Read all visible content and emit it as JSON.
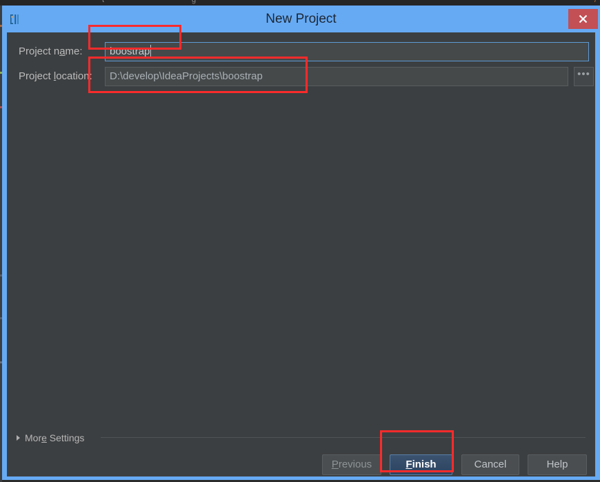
{
  "window": {
    "title": "New Project",
    "app_icon": "intellij-idea-icon",
    "close_label": "✕"
  },
  "form": {
    "name_label_pre": "Project n",
    "name_label_mnemonic": "a",
    "name_label_post": "me:",
    "name_value": "boostrap",
    "name_placeholder": "Project name",
    "location_label_pre": "Project ",
    "location_label_mnemonic": "l",
    "location_label_post": "ocation:",
    "location_value": "D:\\develop\\IdeaProjects\\boostrap",
    "location_placeholder": "Project location",
    "browse_label": "•••"
  },
  "more_settings": {
    "label_pre": "Mor",
    "label_mnemonic": "e",
    "label_post": " Settings",
    "expanded": "false",
    "triangle_icon": "chevron-right-icon"
  },
  "buttons": {
    "previous_pre": "",
    "previous_mnemonic": "P",
    "previous_post": "revious",
    "finish_pre": "",
    "finish_mnemonic": "F",
    "finish_post": "inish",
    "cancel": "Cancel",
    "help": "Help"
  },
  "annotations": {
    "name_box": "highlight-project-name",
    "location_box": "highlight-project-location",
    "finish_box": "highlight-finish-button",
    "color": "#fc2b2b"
  },
  "desktop": {
    "ghost_fragments": [
      "t",
      "g",
      "/"
    ]
  },
  "colors": {
    "frame_blue": "#66aaf4",
    "panel": "#3c3f41",
    "field": "#45494a",
    "focus_border": "#5c9ad6",
    "close_red": "#c25055",
    "default_button": "#2c4361",
    "annotation_red": "#fc2b2b"
  }
}
